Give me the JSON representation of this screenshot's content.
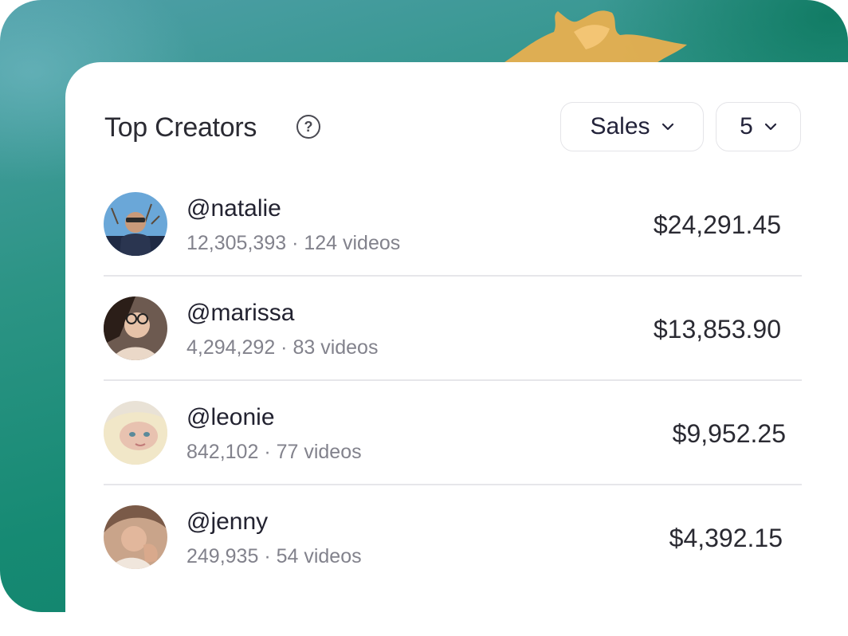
{
  "widget": {
    "title": "Top Creators",
    "help_icon": "question-circle-icon",
    "metric_dropdown": {
      "selected": "Sales",
      "icon": "chevron-down-icon"
    },
    "count_dropdown": {
      "selected": "5",
      "icon": "chevron-down-icon"
    }
  },
  "creators": [
    {
      "handle": "@natalie",
      "followers": "12,305,393",
      "videos": "124 videos",
      "amount": "$24,291.45"
    },
    {
      "handle": "@marissa",
      "followers": "4,294,292",
      "videos": "83 videos",
      "amount": "$13,853.90"
    },
    {
      "handle": "@leonie",
      "followers": "842,102",
      "videos": "77 videos",
      "amount": "$9,952.25"
    },
    {
      "handle": "@jenny",
      "followers": "249,935",
      "videos": "54 videos",
      "amount": "$4,392.15"
    }
  ],
  "separator": " · ",
  "colors": {
    "background_teal": "#168a73",
    "card": "#ffffff",
    "text_primary": "#222230",
    "text_secondary": "#82828c"
  }
}
